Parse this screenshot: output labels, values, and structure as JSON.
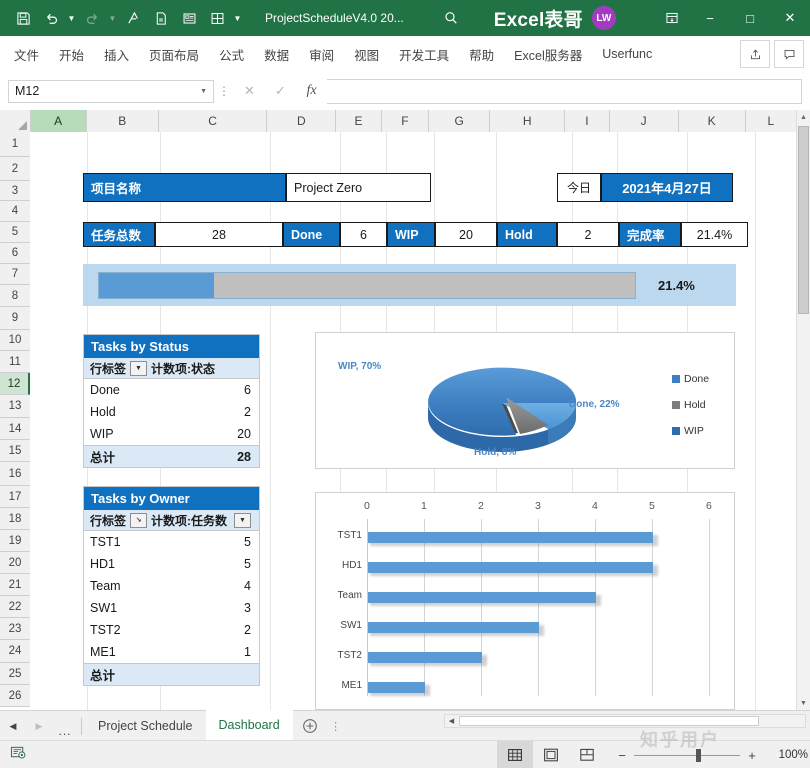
{
  "titlebar": {
    "quick_access": [
      "save-icon",
      "undo-icon",
      "redo-icon",
      "touch-mode-icon",
      "print-preview-icon",
      "form-icon",
      "table-icon",
      "customize-icon"
    ],
    "document_title": "ProjectScheduleV4.0 20...",
    "search_icon": "search-icon",
    "brand": "Excel表哥",
    "avatar_initials": "LW",
    "ribbon_display_icon": "ribbon-display-options-icon",
    "minimize": "−",
    "maximize": "□",
    "close": "✕"
  },
  "ribbon": {
    "tabs": [
      "文件",
      "开始",
      "插入",
      "页面布局",
      "公式",
      "数据",
      "审阅",
      "视图",
      "开发工具",
      "帮助",
      "Excel服务器",
      "Userfunc"
    ],
    "share_icon": "share-icon",
    "comment_icon": "comment-icon"
  },
  "formula_bar": {
    "name_box_value": "M12",
    "cancel_icon": "✕",
    "confirm_icon": "✓",
    "function_icon": "fx",
    "formula_value": ""
  },
  "grid": {
    "columns": [
      "A",
      "B",
      "C",
      "D",
      "E",
      "F",
      "G",
      "H",
      "I",
      "J",
      "K",
      "L"
    ],
    "selected_column": "A",
    "rows": [
      1,
      2,
      3,
      4,
      5,
      6,
      7,
      8,
      9,
      10,
      11,
      12,
      13,
      14,
      15,
      16,
      17,
      18,
      19,
      20,
      21,
      22,
      23,
      24,
      25,
      26
    ],
    "selected_row": 12
  },
  "dashboard": {
    "project_name_label": "项目名称",
    "project_name_value": "Project Zero",
    "today_label": "今日",
    "today_value": "2021年4月27日",
    "stats": [
      {
        "label": "任务总数",
        "value": "28"
      },
      {
        "label": "Done",
        "value": "6"
      },
      {
        "label": "WIP",
        "value": "20"
      },
      {
        "label": "Hold",
        "value": "2"
      },
      {
        "label": "完成率",
        "value": "21.4%"
      }
    ],
    "progress": {
      "percent_text": "21.4%",
      "percent_value": 21.4,
      "fill_color": "#5b9bd5",
      "track_color": "#bfbfbf",
      "panel_color": "#bcd8ef"
    },
    "pivot_status": {
      "title": "Tasks by Status",
      "header_row_label": "行标签",
      "header_value_label": "计数项:状态",
      "rows": [
        {
          "label": "Done",
          "value": "6"
        },
        {
          "label": "Hold",
          "value": "2"
        },
        {
          "label": "WIP",
          "value": "20"
        }
      ],
      "total_label": "总计",
      "total_value": "28"
    },
    "pivot_owner": {
      "title": "Tasks by Owner",
      "header_row_label": "行标签",
      "header_value_label": "计数项:任务数",
      "rows": [
        {
          "label": "TST1",
          "value": "5"
        },
        {
          "label": "HD1",
          "value": "5"
        },
        {
          "label": "Team",
          "value": "4"
        },
        {
          "label": "SW1",
          "value": "3"
        },
        {
          "label": "TST2",
          "value": "2"
        },
        {
          "label": "ME1",
          "value": "1"
        }
      ],
      "total_label": "总计",
      "total_value": ""
    }
  },
  "chart_data": [
    {
      "type": "pie",
      "title": "",
      "categories": [
        "Done",
        "Hold",
        "WIP"
      ],
      "values": [
        22,
        8,
        70
      ],
      "labels": [
        "Done, 22%",
        "Hold, 8%",
        "WIP, 70%"
      ],
      "legend": [
        "Done",
        "Hold",
        "WIP"
      ],
      "legend_position": "right",
      "colors": [
        "#4a90d9",
        "#808080",
        "#3978c0"
      ],
      "label_color": "#4a88c7",
      "three_d": true
    },
    {
      "type": "bar",
      "title": "",
      "categories": [
        "TST1",
        "HD1",
        "Team",
        "SW1",
        "TST2",
        "ME1"
      ],
      "values": [
        5,
        5,
        4,
        3,
        2,
        1
      ],
      "xlabel": "",
      "ylabel": "",
      "xlim": [
        0,
        6
      ],
      "xticks": [
        "0",
        "1",
        "2",
        "3",
        "4",
        "5",
        "6"
      ],
      "orientation": "horizontal",
      "bar_color": "#5b9bd5",
      "grid": true,
      "axis_position": "top"
    }
  ],
  "sheet_tabs": {
    "prev_icon": "◀",
    "next_icon": "▶",
    "more_icon": "...",
    "tabs": [
      {
        "name": "Project Schedule",
        "active": false
      },
      {
        "name": "Dashboard",
        "active": true
      }
    ],
    "add_sheet_icon": "⊕",
    "overflow_icon": "⋮"
  },
  "status_bar": {
    "macro_icon": "record-macro-icon",
    "views": [
      {
        "name": "normal-view",
        "active": true
      },
      {
        "name": "page-layout-view",
        "active": false
      },
      {
        "name": "page-break-view",
        "active": false
      }
    ],
    "zoom_out": "−",
    "zoom_in": "+",
    "zoom_level": "100%"
  },
  "watermark": "知乎用户"
}
